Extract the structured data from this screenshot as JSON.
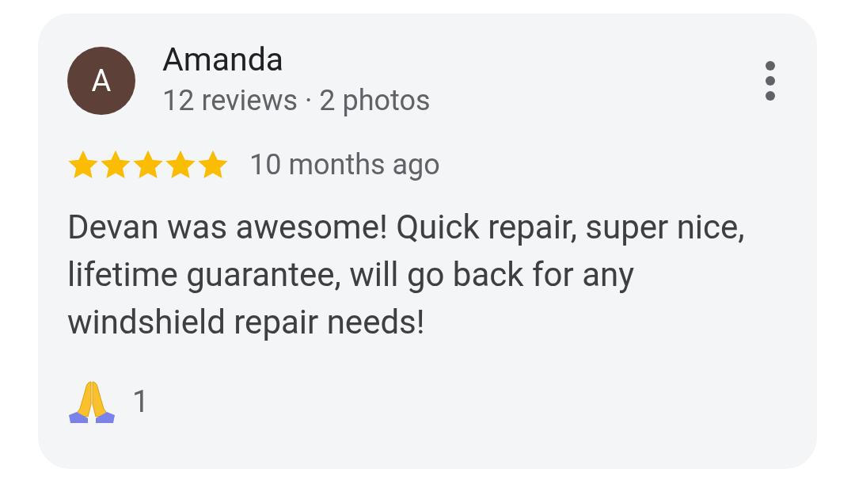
{
  "review": {
    "avatar_letter": "A",
    "author": "Amanda",
    "author_meta": "12 reviews · 2 photos",
    "stars": 5,
    "date": "10 months ago",
    "text": "Devan was awesome! Quick repair, super nice, lifetime guarantee, will go back for any windshield repair needs!",
    "reactions": [
      {
        "kind": "thanks",
        "count": "1"
      }
    ]
  }
}
